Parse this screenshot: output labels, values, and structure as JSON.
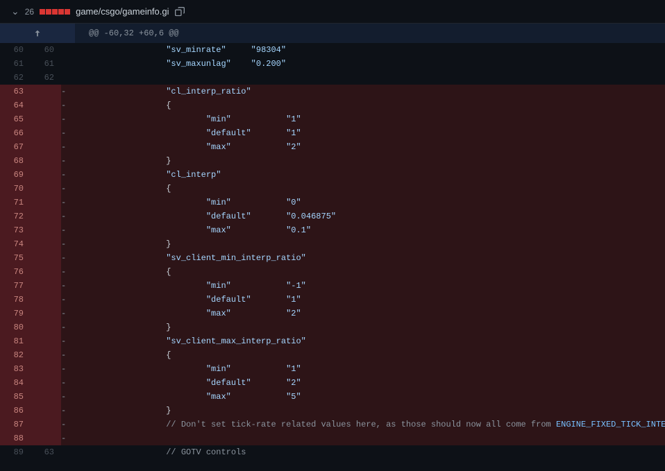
{
  "file": {
    "change_count": "26",
    "path": "game/csgo/gameinfo.gi"
  },
  "hunk": "@@ -60,32 +60,6 @@",
  "rows": [
    {
      "type": "ctx",
      "lold": "60",
      "lnew": "60",
      "tokens": [
        {
          "t": "                    ",
          "c": ""
        },
        {
          "t": "\"sv_minrate\"",
          "c": "s"
        },
        {
          "t": "     ",
          "c": ""
        },
        {
          "t": "\"98304\"",
          "c": "s"
        }
      ]
    },
    {
      "type": "ctx",
      "lold": "61",
      "lnew": "61",
      "tokens": [
        {
          "t": "                    ",
          "c": ""
        },
        {
          "t": "\"sv_maxunlag\"",
          "c": "s"
        },
        {
          "t": "    ",
          "c": ""
        },
        {
          "t": "\"0.200\"",
          "c": "s"
        }
      ]
    },
    {
      "type": "ctx",
      "lold": "62",
      "lnew": "62",
      "tokens": []
    },
    {
      "type": "del",
      "lold": "63",
      "lnew": "",
      "tokens": [
        {
          "t": "                    ",
          "c": ""
        },
        {
          "t": "\"cl_interp_ratio\"",
          "c": "s"
        }
      ]
    },
    {
      "type": "del",
      "lold": "64",
      "lnew": "",
      "tokens": [
        {
          "t": "                    {",
          "c": ""
        }
      ]
    },
    {
      "type": "del",
      "lold": "65",
      "lnew": "",
      "tokens": [
        {
          "t": "                            ",
          "c": ""
        },
        {
          "t": "\"min\"",
          "c": "s"
        },
        {
          "t": "           ",
          "c": ""
        },
        {
          "t": "\"1\"",
          "c": "s"
        }
      ]
    },
    {
      "type": "del",
      "lold": "66",
      "lnew": "",
      "tokens": [
        {
          "t": "                            ",
          "c": ""
        },
        {
          "t": "\"default\"",
          "c": "s"
        },
        {
          "t": "       ",
          "c": ""
        },
        {
          "t": "\"1\"",
          "c": "s"
        }
      ]
    },
    {
      "type": "del",
      "lold": "67",
      "lnew": "",
      "tokens": [
        {
          "t": "                            ",
          "c": ""
        },
        {
          "t": "\"max\"",
          "c": "s"
        },
        {
          "t": "           ",
          "c": ""
        },
        {
          "t": "\"2\"",
          "c": "s"
        }
      ]
    },
    {
      "type": "del",
      "lold": "68",
      "lnew": "",
      "tokens": [
        {
          "t": "                    }",
          "c": ""
        }
      ]
    },
    {
      "type": "del",
      "lold": "69",
      "lnew": "",
      "tokens": [
        {
          "t": "                    ",
          "c": ""
        },
        {
          "t": "\"cl_interp\"",
          "c": "s"
        }
      ]
    },
    {
      "type": "del",
      "lold": "70",
      "lnew": "",
      "tokens": [
        {
          "t": "                    {",
          "c": ""
        }
      ]
    },
    {
      "type": "del",
      "lold": "71",
      "lnew": "",
      "tokens": [
        {
          "t": "                            ",
          "c": ""
        },
        {
          "t": "\"min\"",
          "c": "s"
        },
        {
          "t": "           ",
          "c": ""
        },
        {
          "t": "\"0\"",
          "c": "s"
        }
      ]
    },
    {
      "type": "del",
      "lold": "72",
      "lnew": "",
      "tokens": [
        {
          "t": "                            ",
          "c": ""
        },
        {
          "t": "\"default\"",
          "c": "s"
        },
        {
          "t": "       ",
          "c": ""
        },
        {
          "t": "\"0.046875\"",
          "c": "s"
        }
      ]
    },
    {
      "type": "del",
      "lold": "73",
      "lnew": "",
      "tokens": [
        {
          "t": "                            ",
          "c": ""
        },
        {
          "t": "\"max\"",
          "c": "s"
        },
        {
          "t": "           ",
          "c": ""
        },
        {
          "t": "\"0.1\"",
          "c": "s"
        }
      ]
    },
    {
      "type": "del",
      "lold": "74",
      "lnew": "",
      "tokens": [
        {
          "t": "                    }",
          "c": ""
        }
      ]
    },
    {
      "type": "del",
      "lold": "75",
      "lnew": "",
      "tokens": [
        {
          "t": "                    ",
          "c": ""
        },
        {
          "t": "\"sv_client_min_interp_ratio\"",
          "c": "s"
        }
      ]
    },
    {
      "type": "del",
      "lold": "76",
      "lnew": "",
      "tokens": [
        {
          "t": "                    {",
          "c": ""
        }
      ]
    },
    {
      "type": "del",
      "lold": "77",
      "lnew": "",
      "tokens": [
        {
          "t": "                            ",
          "c": ""
        },
        {
          "t": "\"min\"",
          "c": "s"
        },
        {
          "t": "           ",
          "c": ""
        },
        {
          "t": "\"-1\"",
          "c": "s"
        }
      ]
    },
    {
      "type": "del",
      "lold": "78",
      "lnew": "",
      "tokens": [
        {
          "t": "                            ",
          "c": ""
        },
        {
          "t": "\"default\"",
          "c": "s"
        },
        {
          "t": "       ",
          "c": ""
        },
        {
          "t": "\"1\"",
          "c": "s"
        }
      ]
    },
    {
      "type": "del",
      "lold": "79",
      "lnew": "",
      "tokens": [
        {
          "t": "                            ",
          "c": ""
        },
        {
          "t": "\"max\"",
          "c": "s"
        },
        {
          "t": "           ",
          "c": ""
        },
        {
          "t": "\"2\"",
          "c": "s"
        }
      ]
    },
    {
      "type": "del",
      "lold": "80",
      "lnew": "",
      "tokens": [
        {
          "t": "                    }",
          "c": ""
        }
      ]
    },
    {
      "type": "del",
      "lold": "81",
      "lnew": "",
      "tokens": [
        {
          "t": "                    ",
          "c": ""
        },
        {
          "t": "\"sv_client_max_interp_ratio\"",
          "c": "s"
        }
      ]
    },
    {
      "type": "del",
      "lold": "82",
      "lnew": "",
      "tokens": [
        {
          "t": "                    {",
          "c": ""
        }
      ]
    },
    {
      "type": "del",
      "lold": "83",
      "lnew": "",
      "tokens": [
        {
          "t": "                            ",
          "c": ""
        },
        {
          "t": "\"min\"",
          "c": "s"
        },
        {
          "t": "           ",
          "c": ""
        },
        {
          "t": "\"1\"",
          "c": "s"
        }
      ]
    },
    {
      "type": "del",
      "lold": "84",
      "lnew": "",
      "tokens": [
        {
          "t": "                            ",
          "c": ""
        },
        {
          "t": "\"default\"",
          "c": "s"
        },
        {
          "t": "       ",
          "c": ""
        },
        {
          "t": "\"2\"",
          "c": "s"
        }
      ]
    },
    {
      "type": "del",
      "lold": "85",
      "lnew": "",
      "tokens": [
        {
          "t": "                            ",
          "c": ""
        },
        {
          "t": "\"max\"",
          "c": "s"
        },
        {
          "t": "           ",
          "c": ""
        },
        {
          "t": "\"5\"",
          "c": "s"
        }
      ]
    },
    {
      "type": "del",
      "lold": "86",
      "lnew": "",
      "tokens": [
        {
          "t": "                    }",
          "c": ""
        }
      ]
    },
    {
      "type": "del",
      "lold": "87",
      "lnew": "",
      "tokens": [
        {
          "t": "                    ",
          "c": ""
        },
        {
          "t": "// Don't set tick-rate related values here, as those should now all come from ",
          "c": "c"
        },
        {
          "t": "ENGINE_FIXED_TICK_INTERVAL",
          "c": "con"
        }
      ]
    },
    {
      "type": "del",
      "lold": "88",
      "lnew": "",
      "tokens": []
    },
    {
      "type": "ctx",
      "lold": "89",
      "lnew": "63",
      "tokens": [
        {
          "t": "                    ",
          "c": ""
        },
        {
          "t": "// GOTV controls",
          "c": "c"
        }
      ]
    }
  ]
}
